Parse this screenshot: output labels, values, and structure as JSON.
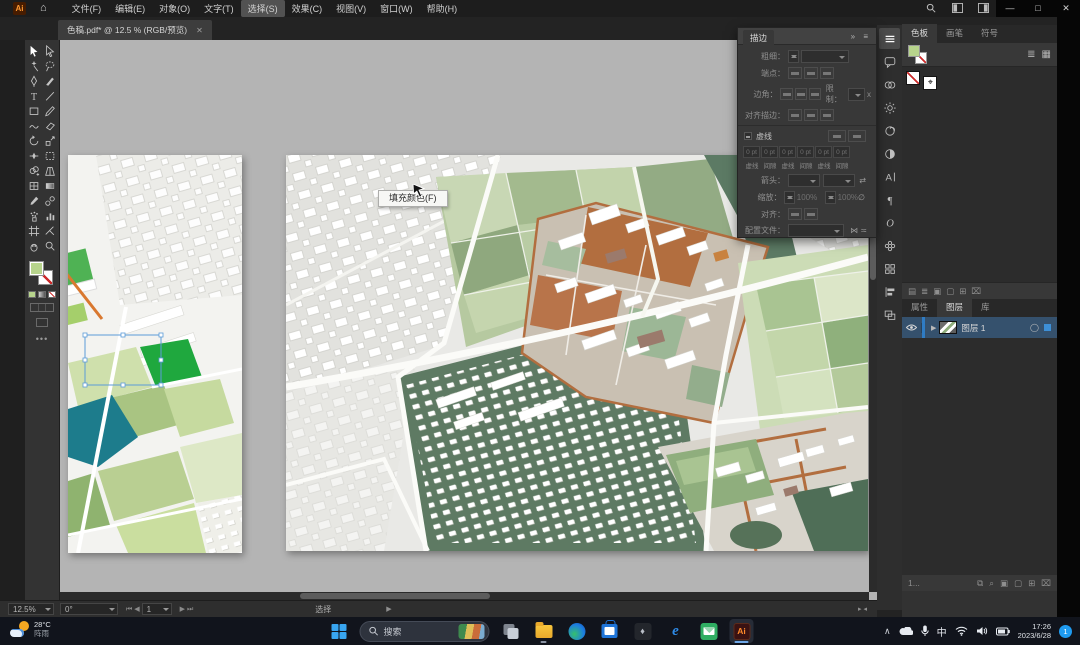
{
  "app": {
    "logo_text": "Ai"
  },
  "titlebar": {
    "menus": [
      {
        "name": "menu-file",
        "label": "文件(F)"
      },
      {
        "name": "menu-edit",
        "label": "编辑(E)"
      },
      {
        "name": "menu-object",
        "label": "对象(O)"
      },
      {
        "name": "menu-type",
        "label": "文字(T)"
      },
      {
        "name": "menu-select",
        "label": "选择(S)",
        "active": true
      },
      {
        "name": "menu-effect",
        "label": "效果(C)"
      },
      {
        "name": "menu-view",
        "label": "视图(V)"
      },
      {
        "name": "menu-window",
        "label": "窗口(W)"
      },
      {
        "name": "menu-help",
        "label": "帮助(H)"
      }
    ],
    "window_controls": {
      "minimize": "—",
      "restore": "□",
      "close": "✕"
    }
  },
  "tabbar": {
    "document_tab": {
      "label": "色稿.pdf* @ 12.5 % (RGB/预览)",
      "close": "✕"
    }
  },
  "toolbar": {
    "tools": [
      {
        "name": "tool-selection",
        "icon": "#t-sel",
        "active": true
      },
      {
        "name": "tool-direct-selection",
        "icon": "#t-dsel"
      },
      {
        "name": "tool-magic-wand",
        "icon": "#t-wand"
      },
      {
        "name": "tool-lasso",
        "icon": "#t-lasso"
      },
      {
        "name": "tool-pen",
        "icon": "#t-pen"
      },
      {
        "name": "tool-paintbrush",
        "icon": "#t-brush"
      },
      {
        "name": "tool-type",
        "icon": "#t-type"
      },
      {
        "name": "tool-line",
        "icon": "#t-line"
      },
      {
        "name": "tool-rectangle",
        "icon": "#t-rect"
      },
      {
        "name": "tool-pencil",
        "icon": "#t-pencil"
      },
      {
        "name": "tool-shaper",
        "icon": "#t-shaper"
      },
      {
        "name": "tool-eraser",
        "icon": "#t-eraser"
      },
      {
        "name": "tool-rotate",
        "icon": "#t-rotate"
      },
      {
        "name": "tool-scale",
        "icon": "#t-scale"
      },
      {
        "name": "tool-width",
        "icon": "#t-width"
      },
      {
        "name": "tool-free-transform",
        "icon": "#t-free"
      },
      {
        "name": "tool-shape-builder",
        "icon": "#t-builder"
      },
      {
        "name": "tool-perspective-grid",
        "icon": "#t-persp"
      },
      {
        "name": "tool-mesh",
        "icon": "#t-mesh"
      },
      {
        "name": "tool-gradient",
        "icon": "#t-grad"
      },
      {
        "name": "tool-eyedropper",
        "icon": "#t-eyed"
      },
      {
        "name": "tool-blend",
        "icon": "#t-blend"
      },
      {
        "name": "tool-symbol-sprayer",
        "icon": "#t-spray"
      },
      {
        "name": "tool-column-graph",
        "icon": "#t-graph"
      },
      {
        "name": "tool-artboard",
        "icon": "#t-board"
      },
      {
        "name": "tool-slice",
        "icon": "#t-slice"
      },
      {
        "name": "tool-hand",
        "icon": "#t-hand"
      },
      {
        "name": "tool-zoom",
        "icon": "#t-zoom"
      }
    ]
  },
  "stroke_panel": {
    "title": "描边",
    "collapse_icon": "»",
    "menu_icon": "≡",
    "weight_label": "粗细：",
    "cap_label": "端点：",
    "corner_label": "边角：",
    "limit_label": "限制：",
    "limit_unit": "x",
    "align_stroke_label": "对齐描边：",
    "dashed_label": "虚线",
    "dash_fields": [
      {
        "value": "0 pt",
        "label": "虚线"
      },
      {
        "value": "0 pt",
        "label": "间隙"
      },
      {
        "value": "0 pt",
        "label": "虚线"
      },
      {
        "value": "0 pt",
        "label": "间隙"
      },
      {
        "value": "0 pt",
        "label": "虚线"
      },
      {
        "value": "0 pt",
        "label": "间隙"
      }
    ],
    "arrow_label": "箭头：",
    "swap_icon": "⇄",
    "scale_label": "缩放：",
    "scale_values": [
      "100%",
      "100%"
    ],
    "link_icon": "∅",
    "align_label": "对齐：",
    "profile_label": "配置文件：",
    "profile_icons": "⋈ ≍"
  },
  "dock": {
    "icons": [
      {
        "name": "dock-menu-icon",
        "icon": "#d-menu",
        "active": true
      },
      {
        "name": "dock-comments-icon",
        "icon": "#d-chat"
      },
      {
        "name": "dock-transparency-icon",
        "icon": "#d-circles"
      },
      {
        "name": "dock-appearance-icon",
        "icon": "#d-sun"
      },
      {
        "name": "dock-color-guide-icon",
        "icon": "#d-swirl"
      },
      {
        "name": "dock-gradient-icon",
        "icon": "#d-grad"
      },
      {
        "name": "dock-character-icon",
        "icon": "#d-charA"
      },
      {
        "name": "dock-paragraph-icon",
        "icon": "#d-para"
      },
      {
        "name": "dock-opentype-icon",
        "icon": "#d-openO"
      },
      {
        "name": "dock-symbols-icon",
        "icon": "#d-flower"
      },
      {
        "name": "dock-pattern-icon",
        "icon": "#d-grid"
      },
      {
        "name": "dock-align-icon",
        "icon": "#d-align"
      },
      {
        "name": "dock-artboards-icon",
        "icon": "#d-boards"
      }
    ]
  },
  "panels": {
    "swatches": {
      "tabs": [
        {
          "name": "tab-swatches",
          "label": "色板",
          "active": true
        },
        {
          "name": "tab-brushes",
          "label": "画笔"
        },
        {
          "name": "tab-symbols",
          "label": "符号"
        }
      ],
      "menu_icon": "≡",
      "view_icons": {
        "list": "≣",
        "grid": "▦"
      },
      "registration_glyph": "⌖",
      "fill_color": "#b7d48c",
      "footer_icons": [
        {
          "name": "swatch-libraries-icon",
          "glyph": "▤"
        },
        {
          "name": "swatch-kind-menu-icon",
          "glyph": "≣"
        },
        {
          "name": "swatch-options-icon",
          "glyph": "▣"
        },
        {
          "name": "new-color-group-icon",
          "glyph": "▢"
        },
        {
          "name": "new-swatch-icon",
          "glyph": "⊞"
        },
        {
          "name": "delete-swatch-icon",
          "glyph": "⌧"
        }
      ]
    },
    "layers": {
      "tabs": [
        {
          "name": "tab-properties",
          "label": "属性"
        },
        {
          "name": "tab-layers",
          "label": "图层",
          "active": true
        },
        {
          "name": "tab-libraries",
          "label": "库"
        }
      ],
      "menu_icon": "≡",
      "expand_icon": "▶",
      "target_icon": "◯",
      "rows": [
        {
          "name": "图层 1"
        }
      ],
      "footer_count": "1...",
      "footer_icons": [
        {
          "name": "collect-export-icon",
          "glyph": "⧉"
        },
        {
          "name": "locate-object-icon",
          "glyph": "⌕"
        },
        {
          "name": "make-mask-icon",
          "glyph": "▣"
        },
        {
          "name": "new-sublayer-icon",
          "glyph": "▢"
        },
        {
          "name": "new-layer-icon",
          "glyph": "⊞"
        },
        {
          "name": "delete-layer-icon",
          "glyph": "⌧"
        }
      ]
    }
  },
  "statusbar": {
    "zoom": "12.5%",
    "rotation": "0°",
    "nav_icons": "⏮ ◀",
    "artboard_number": "1",
    "nav_icons_right": "▶ ⏭",
    "status": "选择",
    "play_icon": "▶",
    "split_icons": "▸ ◂"
  },
  "canvas": {
    "tooltip": "填充颜色(F)"
  },
  "taskbar": {
    "weather": {
      "temp": "28°C",
      "condition": "阵雨"
    },
    "search": {
      "placeholder": "搜索"
    },
    "apps": {
      "ai_label": "Ai",
      "e_label": "e"
    },
    "tray": {
      "chevron": "∧",
      "ime": "中",
      "time": "17:26",
      "date": "2023/6/28",
      "badge": "1"
    }
  },
  "artwork": {
    "palette": {
      "pasteboard": "#b4b4b4",
      "paper": "#ffffff",
      "background_gray": "#e9e9e6",
      "sage_light": "#cfdfba",
      "sage": "#a9c292",
      "sage_dark": "#5e7a63",
      "green_bright": "#1fa83e",
      "teal": "#1d7c8c",
      "terracotta": "#b26e3f",
      "mauve": "#9b7a6c",
      "building_white": "#ffffff",
      "selection_blue": "#5b9bd8"
    }
  }
}
